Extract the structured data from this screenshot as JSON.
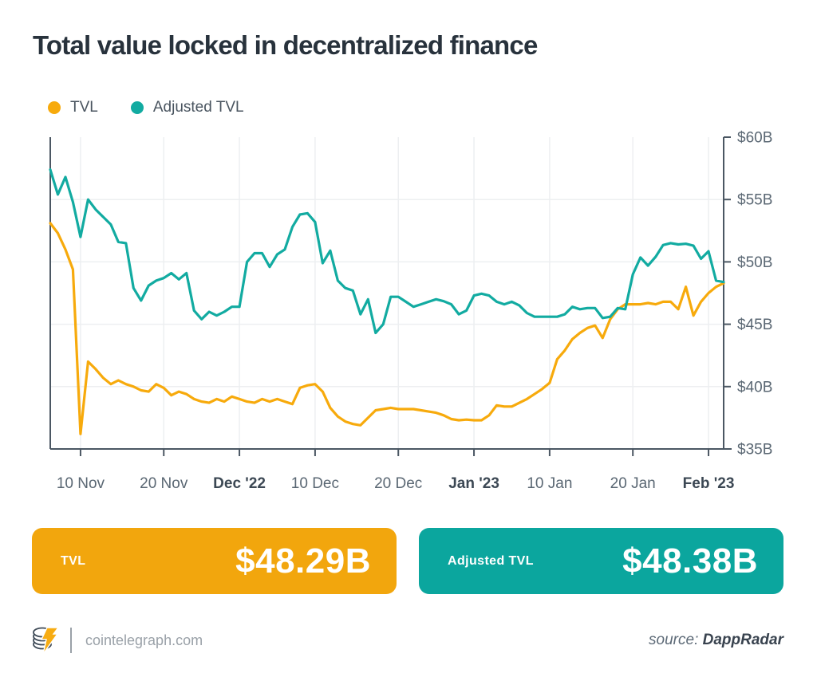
{
  "title": "Total value locked in decentralized finance",
  "legend": {
    "items": [
      {
        "label": "TVL",
        "color": "#f7aa0c"
      },
      {
        "label": "Adjusted TVL",
        "color": "#12aba1"
      }
    ]
  },
  "chart_data": {
    "type": "line",
    "title": "Total value locked in decentralized finance",
    "x_start_date": "2022-11-06",
    "x_end_date": "2023-02-03",
    "x_unit": "day",
    "grid": true,
    "legend_position": "top-left",
    "ylim": [
      35,
      60
    ],
    "y_tick_values": [
      35,
      40,
      45,
      50,
      55,
      60
    ],
    "y_tick_labels": [
      "$35B",
      "$40B",
      "$45B",
      "$50B",
      "$55B",
      "$60B"
    ],
    "y_gridline_values": [
      40,
      45,
      50,
      55
    ],
    "x_tick_labels": [
      {
        "label": "10 Nov",
        "day": 4,
        "bold": false
      },
      {
        "label": "20 Nov",
        "day": 15,
        "bold": false
      },
      {
        "label": "Dec '22",
        "day": 25,
        "bold": true
      },
      {
        "label": "10 Dec",
        "day": 35,
        "bold": false
      },
      {
        "label": "20 Dec",
        "day": 46,
        "bold": false
      },
      {
        "label": "Jan '23",
        "day": 56,
        "bold": true
      },
      {
        "label": "10 Jan",
        "day": 66,
        "bold": false
      },
      {
        "label": "20 Jan",
        "day": 77,
        "bold": false
      },
      {
        "label": "Feb '23",
        "day": 87,
        "bold": true
      }
    ],
    "series": [
      {
        "name": "TVL",
        "color": "#f7aa0c",
        "end_value_label": "$48.29B",
        "values": [
          53.1,
          52.3,
          51.0,
          49.4,
          36.2,
          42.0,
          41.4,
          40.7,
          40.2,
          40.5,
          40.2,
          40.0,
          39.7,
          39.6,
          40.2,
          39.9,
          39.3,
          39.6,
          39.4,
          39.0,
          38.8,
          38.7,
          39.0,
          38.8,
          39.2,
          39.0,
          38.8,
          38.7,
          39.0,
          38.8,
          39.0,
          38.8,
          38.6,
          39.9,
          40.1,
          40.2,
          39.6,
          38.3,
          37.6,
          37.2,
          37.0,
          36.9,
          37.5,
          38.1,
          38.2,
          38.3,
          38.2,
          38.2,
          38.2,
          38.1,
          38.0,
          37.9,
          37.7,
          37.4,
          37.3,
          37.35,
          37.3,
          37.3,
          37.7,
          38.5,
          38.4,
          38.4,
          38.7,
          39.0,
          39.4,
          39.8,
          40.3,
          42.2,
          42.9,
          43.8,
          44.3,
          44.7,
          44.9,
          43.9,
          45.4,
          46.2,
          46.6,
          46.6,
          46.6,
          46.7,
          46.6,
          46.8,
          46.8,
          46.2,
          48.0,
          45.7,
          46.8,
          47.5,
          48.0,
          48.29
        ]
      },
      {
        "name": "Adjusted TVL",
        "color": "#12aba1",
        "end_value_label": "$48.38B",
        "values": [
          57.4,
          55.4,
          56.8,
          54.8,
          52.0,
          55.0,
          54.2,
          53.6,
          53.0,
          51.6,
          51.5,
          47.9,
          46.9,
          48.1,
          48.5,
          48.7,
          49.1,
          48.6,
          49.1,
          46.1,
          45.4,
          46.0,
          45.7,
          46.0,
          46.4,
          46.4,
          50.0,
          50.7,
          50.7,
          49.6,
          50.6,
          51.0,
          52.8,
          53.8,
          53.9,
          53.2,
          49.9,
          50.9,
          48.5,
          47.9,
          47.7,
          45.8,
          47.0,
          44.3,
          45.0,
          47.2,
          47.2,
          46.8,
          46.4,
          46.6,
          46.8,
          47.0,
          46.85,
          46.6,
          45.8,
          46.1,
          47.3,
          47.45,
          47.3,
          46.8,
          46.6,
          46.8,
          46.5,
          45.9,
          45.6,
          45.6,
          45.6,
          45.6,
          45.8,
          46.4,
          46.2,
          46.3,
          46.3,
          45.5,
          45.6,
          46.3,
          46.2,
          49.0,
          50.35,
          49.7,
          50.4,
          51.35,
          51.5,
          51.4,
          51.45,
          51.3,
          50.25,
          50.85,
          48.5,
          48.38
        ]
      }
    ]
  },
  "cards": [
    {
      "label": "TVL",
      "value": "$48.29B",
      "color": "#f2a60d"
    },
    {
      "label": "Adjusted TVL",
      "value": "$48.38B",
      "color": "#0ba69e"
    }
  ],
  "footer": {
    "site": "cointelegraph.com",
    "source_prefix": "source:",
    "source_name": "DappRadar"
  },
  "colors": {
    "title": "#28323c",
    "axis": "#4b5763",
    "tick_label": "#5a6773",
    "tick_label_bold": "#3c4854",
    "grid": "#edeff1",
    "bolt": "#f7ac12",
    "coin_outline": "#3d4956"
  }
}
